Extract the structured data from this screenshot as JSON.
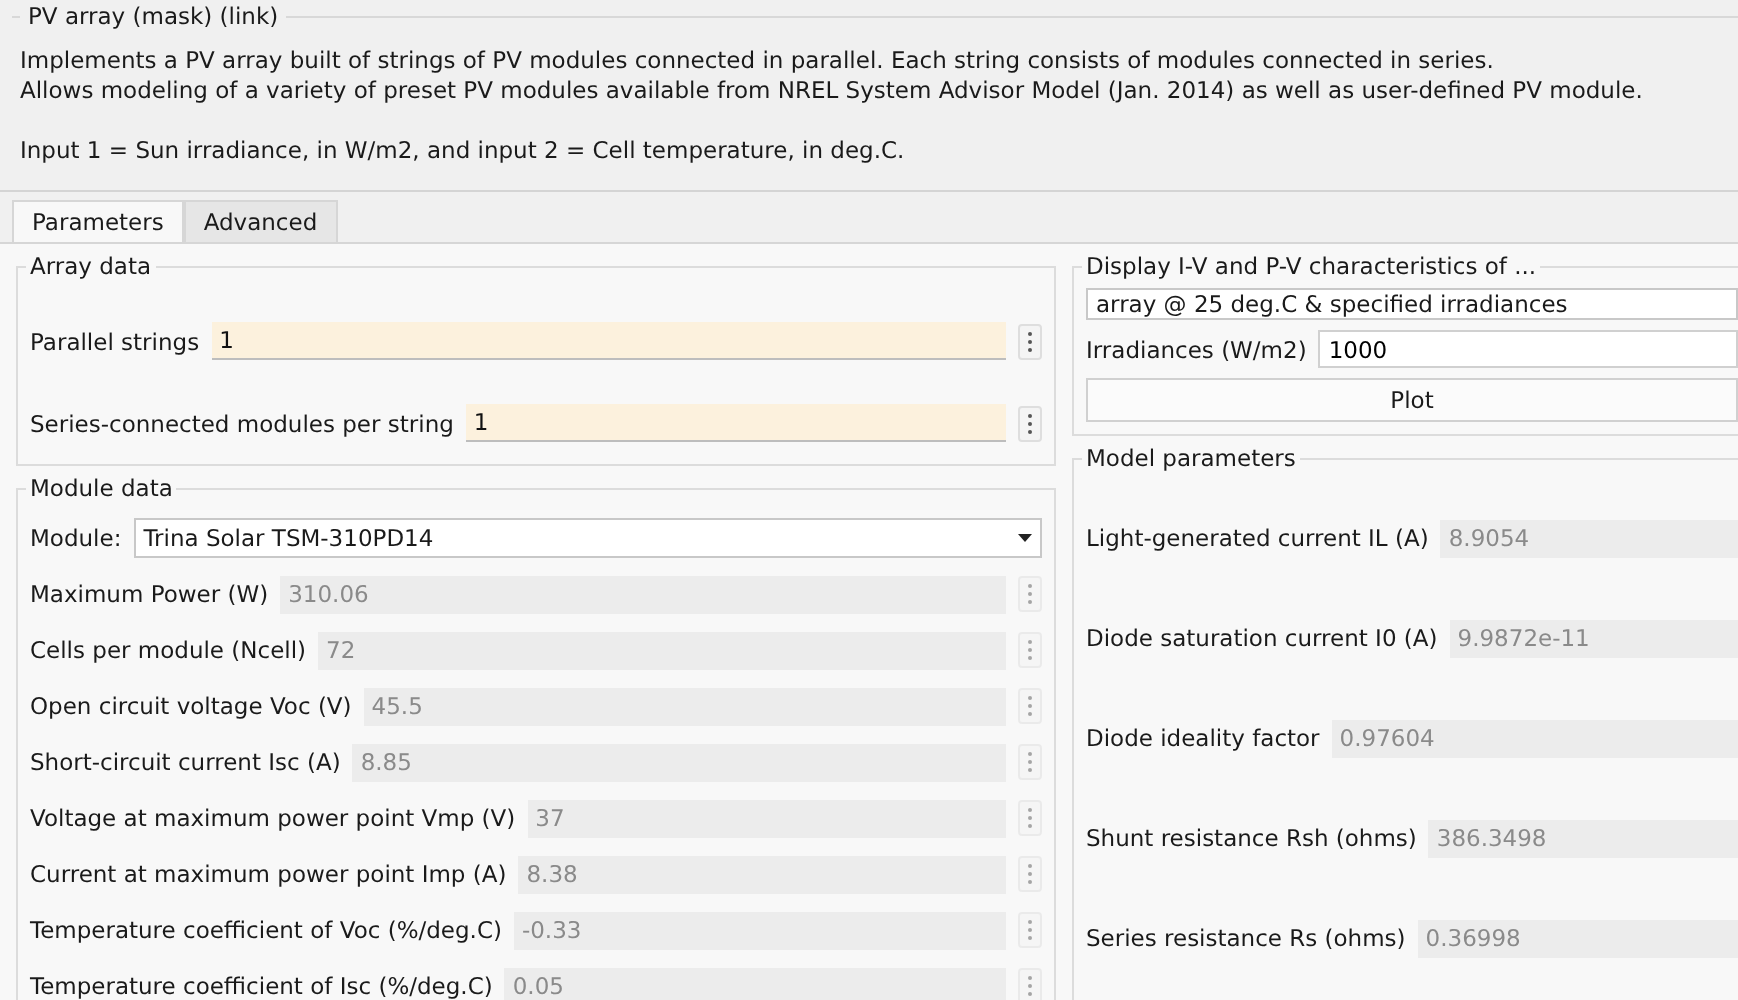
{
  "title": "PV array (mask) (link)",
  "description": [
    "Implements a PV array built of strings of PV modules connected in parallel. Each string consists of modules connected in series.",
    "Allows modeling of a variety of preset PV modules available from NREL System Advisor Model (Jan. 2014) as well as user-defined PV module."
  ],
  "note": "Input 1 = Sun irradiance, in W/m2, and input 2 = Cell temperature, in deg.C.",
  "tabs": [
    {
      "label": "Parameters",
      "selected": true
    },
    {
      "label": "Advanced",
      "selected": false
    }
  ],
  "array_data": {
    "title": "Array data",
    "fields": [
      {
        "label": "Parallel strings",
        "value": "1",
        "disabled": false
      },
      {
        "label": "Series-connected modules per string",
        "value": "1",
        "disabled": false
      }
    ]
  },
  "module_data": {
    "title": "Module data",
    "module": {
      "label": "Module:",
      "value": "Trina Solar TSM-310PD14"
    },
    "fields": [
      {
        "label": "Maximum Power (W)",
        "value": "310.06",
        "disabled": true
      },
      {
        "label": "Cells per module (Ncell)",
        "value": "72",
        "disabled": true
      },
      {
        "label": "Open circuit voltage  Voc (V)",
        "value": "45.5",
        "disabled": true
      },
      {
        "label": "Short-circuit current Isc (A)",
        "value": "8.85",
        "disabled": true
      },
      {
        "label": "Voltage at maximum power point Vmp (V)",
        "value": "37",
        "disabled": true
      },
      {
        "label": "Current at maximum power point Imp (A)",
        "value": "8.38",
        "disabled": true
      },
      {
        "label": "Temperature coefficient of Voc (%/deg.C)",
        "value": "-0.33",
        "disabled": true
      },
      {
        "label": "Temperature coefficient of Isc (%/deg.C)",
        "value": "0.05",
        "disabled": true
      }
    ]
  },
  "display": {
    "title": "Display  I-V and P-V characteristics of ...",
    "selection": "array @ 25 deg.C & specified irradiances",
    "irradiances": {
      "label": "Irradiances (W/m2)",
      "value": "1000"
    },
    "plot_button": "Plot"
  },
  "model_parameters": {
    "title": "Model parameters",
    "fields": [
      {
        "label": "Light-generated current IL (A)",
        "value": "8.9054",
        "disabled": true
      },
      {
        "label": "Diode saturation current I0 (A)",
        "value": "9.9872e-11",
        "disabled": true
      },
      {
        "label": "Diode ideality factor",
        "value": "0.97604",
        "disabled": true
      },
      {
        "label": "Shunt resistance Rsh (ohms)",
        "value": "386.3498",
        "disabled": true
      },
      {
        "label": "Series resistance Rs (ohms)",
        "value": "0.36998",
        "disabled": true
      }
    ]
  }
}
